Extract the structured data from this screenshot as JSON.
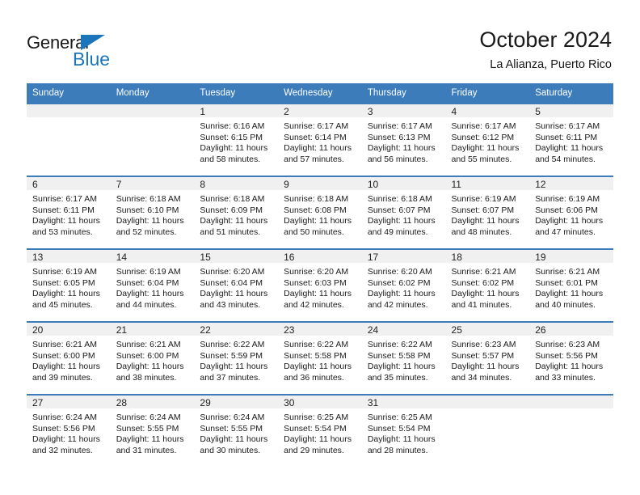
{
  "logo": {
    "word_one": "General",
    "word_two": "Blue",
    "triangle_icon": "triangle-icon",
    "accent_color": "#1b75bb"
  },
  "header": {
    "title": "October 2024",
    "subtitle": "La Alianza, Puerto Rico"
  },
  "calendar": {
    "header_bg": "#3c7cba",
    "daynum_bg": "#f0f0f0",
    "weekday_labels": [
      "Sunday",
      "Monday",
      "Tuesday",
      "Wednesday",
      "Thursday",
      "Friday",
      "Saturday"
    ],
    "labels": {
      "sunrise_prefix": "Sunrise:",
      "sunset_prefix": "Sunset:",
      "daylight_prefix": "Daylight:"
    },
    "weeks": [
      [
        {
          "day": "",
          "sunrise": "",
          "sunset": "",
          "daylight_line1": "",
          "daylight_line2": ""
        },
        {
          "day": "",
          "sunrise": "",
          "sunset": "",
          "daylight_line1": "",
          "daylight_line2": ""
        },
        {
          "day": "1",
          "sunrise": "Sunrise: 6:16 AM",
          "sunset": "Sunset: 6:15 PM",
          "daylight_line1": "Daylight: 11 hours",
          "daylight_line2": "and 58 minutes."
        },
        {
          "day": "2",
          "sunrise": "Sunrise: 6:17 AM",
          "sunset": "Sunset: 6:14 PM",
          "daylight_line1": "Daylight: 11 hours",
          "daylight_line2": "and 57 minutes."
        },
        {
          "day": "3",
          "sunrise": "Sunrise: 6:17 AM",
          "sunset": "Sunset: 6:13 PM",
          "daylight_line1": "Daylight: 11 hours",
          "daylight_line2": "and 56 minutes."
        },
        {
          "day": "4",
          "sunrise": "Sunrise: 6:17 AM",
          "sunset": "Sunset: 6:12 PM",
          "daylight_line1": "Daylight: 11 hours",
          "daylight_line2": "and 55 minutes."
        },
        {
          "day": "5",
          "sunrise": "Sunrise: 6:17 AM",
          "sunset": "Sunset: 6:11 PM",
          "daylight_line1": "Daylight: 11 hours",
          "daylight_line2": "and 54 minutes."
        }
      ],
      [
        {
          "day": "6",
          "sunrise": "Sunrise: 6:17 AM",
          "sunset": "Sunset: 6:11 PM",
          "daylight_line1": "Daylight: 11 hours",
          "daylight_line2": "and 53 minutes."
        },
        {
          "day": "7",
          "sunrise": "Sunrise: 6:18 AM",
          "sunset": "Sunset: 6:10 PM",
          "daylight_line1": "Daylight: 11 hours",
          "daylight_line2": "and 52 minutes."
        },
        {
          "day": "8",
          "sunrise": "Sunrise: 6:18 AM",
          "sunset": "Sunset: 6:09 PM",
          "daylight_line1": "Daylight: 11 hours",
          "daylight_line2": "and 51 minutes."
        },
        {
          "day": "9",
          "sunrise": "Sunrise: 6:18 AM",
          "sunset": "Sunset: 6:08 PM",
          "daylight_line1": "Daylight: 11 hours",
          "daylight_line2": "and 50 minutes."
        },
        {
          "day": "10",
          "sunrise": "Sunrise: 6:18 AM",
          "sunset": "Sunset: 6:07 PM",
          "daylight_line1": "Daylight: 11 hours",
          "daylight_line2": "and 49 minutes."
        },
        {
          "day": "11",
          "sunrise": "Sunrise: 6:19 AM",
          "sunset": "Sunset: 6:07 PM",
          "daylight_line1": "Daylight: 11 hours",
          "daylight_line2": "and 48 minutes."
        },
        {
          "day": "12",
          "sunrise": "Sunrise: 6:19 AM",
          "sunset": "Sunset: 6:06 PM",
          "daylight_line1": "Daylight: 11 hours",
          "daylight_line2": "and 47 minutes."
        }
      ],
      [
        {
          "day": "13",
          "sunrise": "Sunrise: 6:19 AM",
          "sunset": "Sunset: 6:05 PM",
          "daylight_line1": "Daylight: 11 hours",
          "daylight_line2": "and 45 minutes."
        },
        {
          "day": "14",
          "sunrise": "Sunrise: 6:19 AM",
          "sunset": "Sunset: 6:04 PM",
          "daylight_line1": "Daylight: 11 hours",
          "daylight_line2": "and 44 minutes."
        },
        {
          "day": "15",
          "sunrise": "Sunrise: 6:20 AM",
          "sunset": "Sunset: 6:04 PM",
          "daylight_line1": "Daylight: 11 hours",
          "daylight_line2": "and 43 minutes."
        },
        {
          "day": "16",
          "sunrise": "Sunrise: 6:20 AM",
          "sunset": "Sunset: 6:03 PM",
          "daylight_line1": "Daylight: 11 hours",
          "daylight_line2": "and 42 minutes."
        },
        {
          "day": "17",
          "sunrise": "Sunrise: 6:20 AM",
          "sunset": "Sunset: 6:02 PM",
          "daylight_line1": "Daylight: 11 hours",
          "daylight_line2": "and 42 minutes."
        },
        {
          "day": "18",
          "sunrise": "Sunrise: 6:21 AM",
          "sunset": "Sunset: 6:02 PM",
          "daylight_line1": "Daylight: 11 hours",
          "daylight_line2": "and 41 minutes."
        },
        {
          "day": "19",
          "sunrise": "Sunrise: 6:21 AM",
          "sunset": "Sunset: 6:01 PM",
          "daylight_line1": "Daylight: 11 hours",
          "daylight_line2": "and 40 minutes."
        }
      ],
      [
        {
          "day": "20",
          "sunrise": "Sunrise: 6:21 AM",
          "sunset": "Sunset: 6:00 PM",
          "daylight_line1": "Daylight: 11 hours",
          "daylight_line2": "and 39 minutes."
        },
        {
          "day": "21",
          "sunrise": "Sunrise: 6:21 AM",
          "sunset": "Sunset: 6:00 PM",
          "daylight_line1": "Daylight: 11 hours",
          "daylight_line2": "and 38 minutes."
        },
        {
          "day": "22",
          "sunrise": "Sunrise: 6:22 AM",
          "sunset": "Sunset: 5:59 PM",
          "daylight_line1": "Daylight: 11 hours",
          "daylight_line2": "and 37 minutes."
        },
        {
          "day": "23",
          "sunrise": "Sunrise: 6:22 AM",
          "sunset": "Sunset: 5:58 PM",
          "daylight_line1": "Daylight: 11 hours",
          "daylight_line2": "and 36 minutes."
        },
        {
          "day": "24",
          "sunrise": "Sunrise: 6:22 AM",
          "sunset": "Sunset: 5:58 PM",
          "daylight_line1": "Daylight: 11 hours",
          "daylight_line2": "and 35 minutes."
        },
        {
          "day": "25",
          "sunrise": "Sunrise: 6:23 AM",
          "sunset": "Sunset: 5:57 PM",
          "daylight_line1": "Daylight: 11 hours",
          "daylight_line2": "and 34 minutes."
        },
        {
          "day": "26",
          "sunrise": "Sunrise: 6:23 AM",
          "sunset": "Sunset: 5:56 PM",
          "daylight_line1": "Daylight: 11 hours",
          "daylight_line2": "and 33 minutes."
        }
      ],
      [
        {
          "day": "27",
          "sunrise": "Sunrise: 6:24 AM",
          "sunset": "Sunset: 5:56 PM",
          "daylight_line1": "Daylight: 11 hours",
          "daylight_line2": "and 32 minutes."
        },
        {
          "day": "28",
          "sunrise": "Sunrise: 6:24 AM",
          "sunset": "Sunset: 5:55 PM",
          "daylight_line1": "Daylight: 11 hours",
          "daylight_line2": "and 31 minutes."
        },
        {
          "day": "29",
          "sunrise": "Sunrise: 6:24 AM",
          "sunset": "Sunset: 5:55 PM",
          "daylight_line1": "Daylight: 11 hours",
          "daylight_line2": "and 30 minutes."
        },
        {
          "day": "30",
          "sunrise": "Sunrise: 6:25 AM",
          "sunset": "Sunset: 5:54 PM",
          "daylight_line1": "Daylight: 11 hours",
          "daylight_line2": "and 29 minutes."
        },
        {
          "day": "31",
          "sunrise": "Sunrise: 6:25 AM",
          "sunset": "Sunset: 5:54 PM",
          "daylight_line1": "Daylight: 11 hours",
          "daylight_line2": "and 28 minutes."
        },
        {
          "day": "",
          "sunrise": "",
          "sunset": "",
          "daylight_line1": "",
          "daylight_line2": ""
        },
        {
          "day": "",
          "sunrise": "",
          "sunset": "",
          "daylight_line1": "",
          "daylight_line2": ""
        }
      ]
    ]
  }
}
